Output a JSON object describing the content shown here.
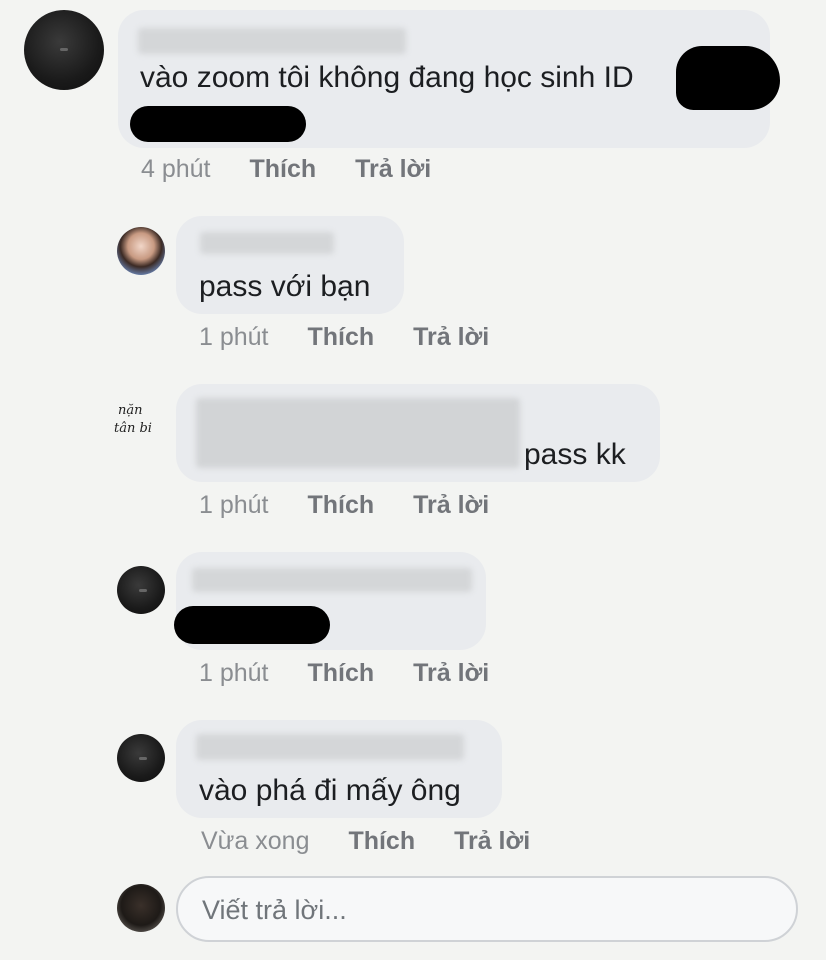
{
  "comments": [
    {
      "text": "vào zoom tôi không đang học sinh ID",
      "time": "4 phút",
      "like": "Thích",
      "reply": "Trả lời"
    },
    {
      "text": "pass với bạn",
      "time": "1 phút",
      "like": "Thích",
      "reply": "Trả lời"
    },
    {
      "text": "pass kk",
      "time": "1 phút",
      "like": "Thích",
      "reply": "Trả lời"
    },
    {
      "text": "",
      "time": "1 phút",
      "like": "Thích",
      "reply": "Trả lời"
    },
    {
      "text": "vào phá đi mấy ông",
      "time": "Vừa xong",
      "like": "Thích",
      "reply": "Trả lời"
    }
  ],
  "avatar_handwriting": "nặn tân bi",
  "reply_input": {
    "placeholder": "Viết trả lời...",
    "value": ""
  },
  "colors": {
    "bubble": "#e9ebee",
    "meta_text": "#8a8d91",
    "background": "#f3f4f2"
  }
}
